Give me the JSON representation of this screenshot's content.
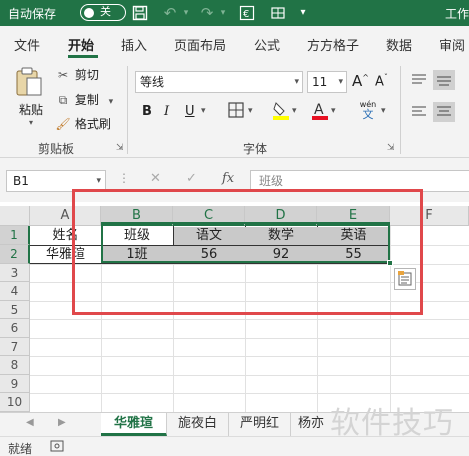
{
  "titlebar": {
    "autosave_label": "自动保存",
    "toggle_state": "关",
    "app_title": "工作"
  },
  "tabs": [
    "文件",
    "开始",
    "插入",
    "页面布局",
    "公式",
    "方方格子",
    "数据",
    "审阅"
  ],
  "active_tab": "开始",
  "ribbon": {
    "clipboard": {
      "paste": "粘贴",
      "cut": "剪切",
      "copy": "复制",
      "format_painter": "格式刷",
      "group_label": "剪贴板"
    },
    "font": {
      "font_name": "等线",
      "font_size": "11",
      "bold": "B",
      "italic": "I",
      "underline": "U",
      "group_label": "字体",
      "phonetic": "wén",
      "phonetic_sub": "文"
    }
  },
  "formula_bar": {
    "name_box": "B1",
    "formula": "班级",
    "fx": "fx"
  },
  "grid": {
    "columns": [
      "A",
      "B",
      "C",
      "D",
      "E",
      "F"
    ],
    "rows": [
      "1",
      "2",
      "3",
      "4",
      "5",
      "6",
      "7",
      "8",
      "9",
      "10"
    ],
    "cells": {
      "A1": "姓名",
      "B1": "班级",
      "C1": "语文",
      "D1": "数学",
      "E1": "英语",
      "A2": "华雅瑄",
      "B2": "1班",
      "C2": "56",
      "D2": "92",
      "E2": "55"
    }
  },
  "sheets": [
    "华雅瑄",
    "旎夜白",
    "严明红",
    "杨亦"
  ],
  "active_sheet": "华雅瑄",
  "status": {
    "ready": "就绪"
  },
  "watermark": "软件技巧",
  "colors": {
    "brand": "#217346",
    "highlight_border": "#e0484b",
    "selection_fill": "#c9c9c9"
  }
}
